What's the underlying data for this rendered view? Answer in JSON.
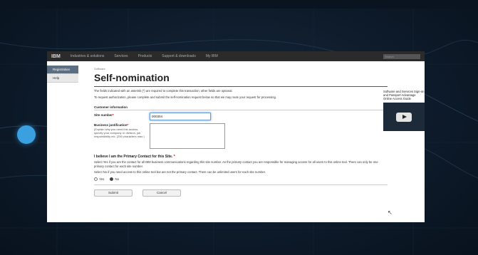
{
  "page": {
    "nav": {
      "brand": "IBM",
      "items": [
        "Industries & solutions",
        "Services",
        "Products",
        "Support & downloads",
        "My IBM"
      ],
      "search": "Search"
    },
    "leftnav": [
      "Registration",
      "Help"
    ],
    "breadcrumb": "Software",
    "title": "Self-nomination",
    "required_note": "The fields indicated with an asterisk (*) are required to complete this transaction; other fields are optional.",
    "request_note": "To request authorization, please complete and submit the self-nomination request below so that we may route your request for processing.",
    "section_title": "Customer information",
    "site_label": "Site number",
    "site_value": "000304",
    "bj_label": "Business justification",
    "bj_hint": "(Explain why you need this access, specify your company or division, job responsibility etc. (250 characters max.)",
    "question": "I believe I am the Primary Contact for this Site.",
    "help1": "Select Yes if you are the contact for all IBM business communications regarding this site number. As the primary contact you are responsible for managing access for all users to this online tool. There can only be one primary contact for each site number.",
    "help2": "Select No if you need access to this online tool but are not the primary contact. There can be unlimited users for each site number.",
    "radio_yes": "Yes",
    "radio_no": "No",
    "submit": "Submit",
    "cancel": "Cancel",
    "side_text": "Software and Services Sign-on and Passport Advantage Online Access Guide"
  },
  "colors": {
    "accent": "#3aa0e0",
    "background": "#0c1826"
  }
}
